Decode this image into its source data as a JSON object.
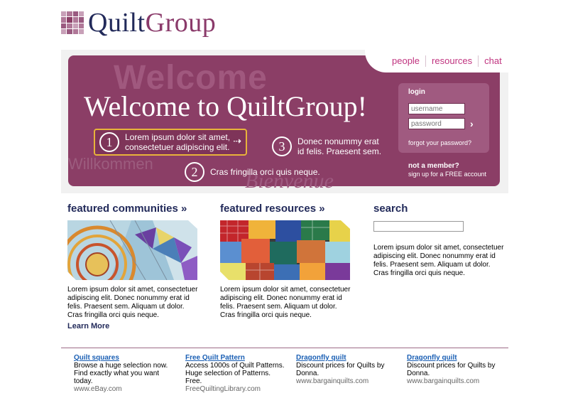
{
  "brand": {
    "part1": "Quilt",
    "part2": "Group"
  },
  "nav": {
    "items": [
      "people",
      "resources",
      "chat"
    ]
  },
  "hero": {
    "watermarks": {
      "welcome": "Welcome",
      "willkommen": "Willkommen",
      "bienvenue": "Bienvenue"
    },
    "title": "Welcome to QuiltGroup!",
    "steps": [
      {
        "num": "1",
        "line1": "Lorem ipsum dolor sit amet,",
        "line2": "consectetuer adipiscing elit."
      },
      {
        "num": "2",
        "line1": "Cras fringilla orci quis neque.",
        "line2": ""
      },
      {
        "num": "3",
        "line1": "Donec nonummy erat",
        "line2": "id felis. Praesent sem."
      }
    ]
  },
  "login": {
    "label": "login",
    "username_placeholder": "username",
    "password_placeholder": "password",
    "forgot": "forgot your password?",
    "not_member": "not a member?",
    "signup": "sign up for a FREE account"
  },
  "columns": {
    "communities": {
      "title": "featured communities »",
      "text": "Lorem ipsum dolor sit amet, consectetuer adipiscing elit. Donec nonummy erat id felis. Praesent sem. Aliquam ut dolor. Cras fringilla orci quis neque.",
      "learn_more": "Learn More"
    },
    "resources": {
      "title": "featured resources »",
      "text": "Lorem ipsum dolor sit amet, consectetuer adipiscing elit. Donec nonummy erat id felis. Praesent sem. Aliquam ut dolor. Cras fringilla orci quis neque."
    },
    "search": {
      "title": "search",
      "text": "Lorem ipsum dolor sit amet, consectetuer adipiscing elit. Donec nonummy erat id felis. Praesent sem. Aliquam ut dolor. Cras fringilla orci quis neque."
    }
  },
  "ads": [
    {
      "title": "Quilt squares",
      "line1": "Browse a huge selection now.",
      "line2": "Find exactly what you want",
      "line3": "today.",
      "url": "www.eBay.com"
    },
    {
      "title": "Free Quilt Pattern",
      "line1": "Access 1000s of Quilt Patterns.",
      "line2": "Huge selection of Patterns.",
      "line3": "Free.",
      "url": "FreeQuiltingLibrary.com"
    },
    {
      "title": "Dragonfly quilt",
      "line1": "Discount prices for Quilts by",
      "line2": "Donna.",
      "line3": "",
      "url": "www.bargainquilts.com"
    },
    {
      "title": "Dragonfly quilt",
      "line1": "Discount prices for Quilts by",
      "line2": "Donna.",
      "line3": "",
      "url": "www.bargainquilts.com"
    }
  ],
  "colors": {
    "brand_navy": "#222a5a",
    "brand_plum": "#8b3e66",
    "nav_pink": "#c0337f",
    "highlight": "#e8b33a"
  },
  "icons": {
    "logo": "quilt-grid-icon",
    "step_arrow": "arrow-right-icon",
    "login_submit": "chevron-right-icon"
  }
}
